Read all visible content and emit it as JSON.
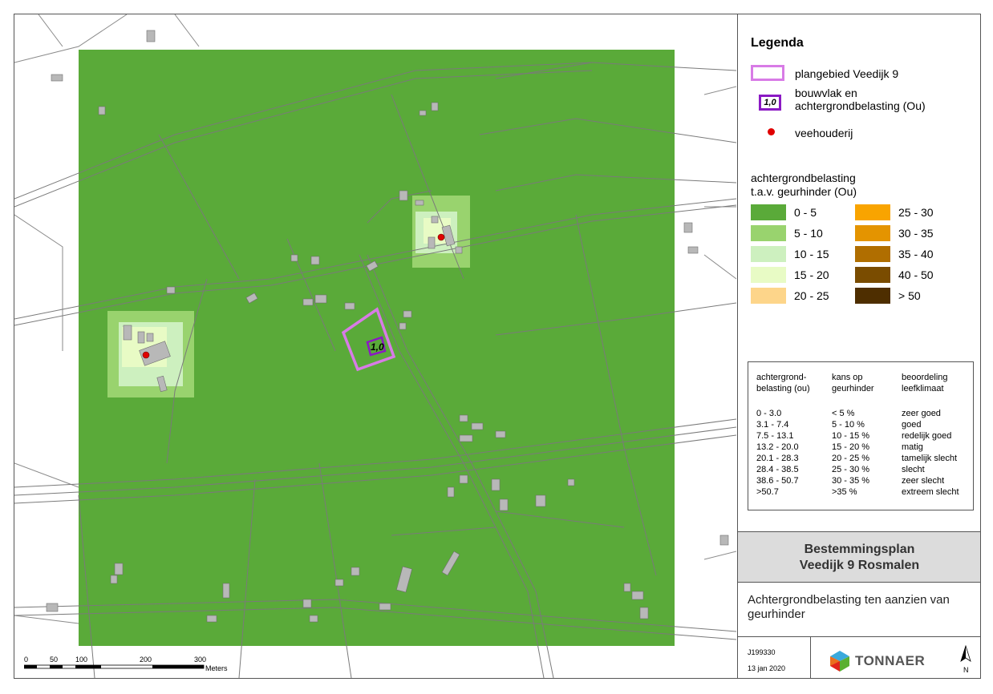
{
  "legend": {
    "title": "Legenda",
    "plangebied_label": "plangebied Veedijk 9",
    "bouwvlak_label_1": "bouwvlak en",
    "bouwvlak_label_2": "achtergrondbelasting (Ou)",
    "bouwvlak_value": "1,0",
    "veehouderij_label": "veehouderij",
    "classes_title_1": "achtergrondbelasting",
    "classes_title_2": "t.a.v. geurhinder (Ou)",
    "classes_left": [
      {
        "label": "0 - 5",
        "color": "#5aaa39"
      },
      {
        "label": "5 - 10",
        "color": "#99d36e"
      },
      {
        "label": "10 - 15",
        "color": "#cdf0bf"
      },
      {
        "label": "15 - 20",
        "color": "#e8fbc5"
      },
      {
        "label": "20 - 25",
        "color": "#fdd58a"
      }
    ],
    "classes_right": [
      {
        "label": "25 - 30",
        "color": "#f9a400"
      },
      {
        "label": "30 - 35",
        "color": "#e49400"
      },
      {
        "label": "35 - 40",
        "color": "#b06e00"
      },
      {
        "label": "40 - 50",
        "color": "#7a4c00"
      },
      {
        "label": "> 50",
        "color": "#4e2e00"
      }
    ],
    "plangebied_color": "#d87be6",
    "bouwvlak_color": "#8b19c4",
    "veehouderij_color": "#e00000"
  },
  "table": {
    "headers": [
      [
        "achtergrond-",
        "belasting (ou)"
      ],
      [
        "kans op",
        "geurhinder"
      ],
      [
        "beoordeling",
        "leefklimaat"
      ]
    ],
    "rows": [
      [
        "0 - 3.0",
        "< 5 %",
        "zeer goed"
      ],
      [
        "3.1 - 7.4",
        "5 - 10 %",
        "goed"
      ],
      [
        "7.5 - 13.1",
        "10 - 15 %",
        "redelijk goed"
      ],
      [
        "13.2 - 20.0",
        "15 - 20 %",
        "matig"
      ],
      [
        "20.1 - 28.3",
        "20 - 25 %",
        "tamelijk slecht"
      ],
      [
        "28.4 - 38.5",
        "25 - 30 %",
        "slecht"
      ],
      [
        "38.6 - 50.7",
        "30 - 35 %",
        "zeer slecht"
      ],
      [
        ">50.7",
        ">35  %",
        "extreem slecht"
      ]
    ]
  },
  "title": {
    "line1": "Bestemmingsplan",
    "line2": "Veedijk 9 Rosmalen",
    "subtitle": "Achtergrondbelasting ten aanzien van geurhinder"
  },
  "footer": {
    "project": "J199330",
    "date": "13 jan 2020",
    "company": "TONNAER",
    "north": "N"
  },
  "scale": {
    "ticks": [
      "0",
      "50",
      "100",
      "200",
      "300"
    ],
    "unit": "Meters"
  },
  "map": {
    "bouwvlak_value": "1,0"
  }
}
